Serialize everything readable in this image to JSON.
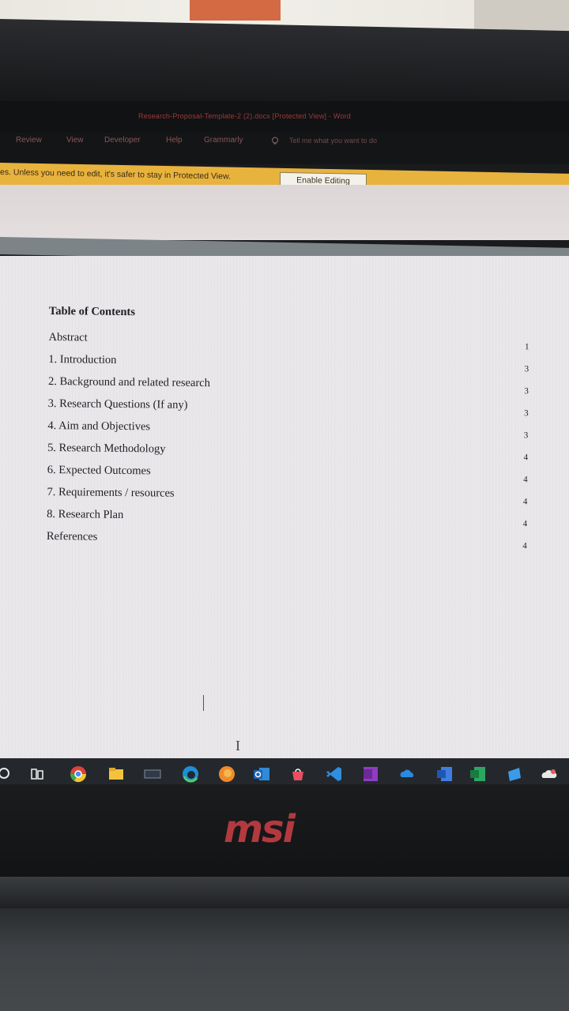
{
  "window": {
    "title": "Research-Proposal-Template-2 (2).docx [Protected View] - Word"
  },
  "ribbon": {
    "tabs": [
      "Review",
      "View",
      "Developer",
      "Help",
      "Grammarly"
    ],
    "tell_me": "Tell me what you want to do"
  },
  "protected_view": {
    "message": "es. Unless you need to edit, it's safer to stay in Protected View.",
    "enable_button": "Enable Editing"
  },
  "document": {
    "toc_title": "Table of Contents",
    "entries": [
      {
        "label": "Abstract",
        "page": "1"
      },
      {
        "label": "1. Introduction",
        "page": "3"
      },
      {
        "label": "2. Background and related research",
        "page": "3"
      },
      {
        "label": "3. Research Questions (If any)",
        "page": "3"
      },
      {
        "label": "4. Aim and Objectives",
        "page": "3"
      },
      {
        "label": "5. Research Methodology",
        "page": "4"
      },
      {
        "label": "6. Expected Outcomes",
        "page": "4"
      },
      {
        "label": "7. Requirements / resources",
        "page": "4"
      },
      {
        "label": "8. Research Plan",
        "page": "4"
      },
      {
        "label": "References",
        "page": "4"
      }
    ],
    "ibeam": "I"
  },
  "taskbar": {
    "icons": [
      "search-icon",
      "task-view-icon",
      "chrome-icon",
      "file-explorer-icon",
      "app-icon",
      "edge-icon",
      "firefox-icon",
      "outlook-icon",
      "ms-store-icon",
      "vscode-icon",
      "onenote-icon",
      "onedrive-icon",
      "word-icon",
      "excel-icon",
      "photos-icon",
      "onedrive-cloud-icon"
    ]
  },
  "laptop": {
    "brand": "msi"
  },
  "colors": {
    "message_bar": "#e8b33d",
    "brand_logo": "#b23a3f",
    "title_text": "#9d3a3a"
  }
}
